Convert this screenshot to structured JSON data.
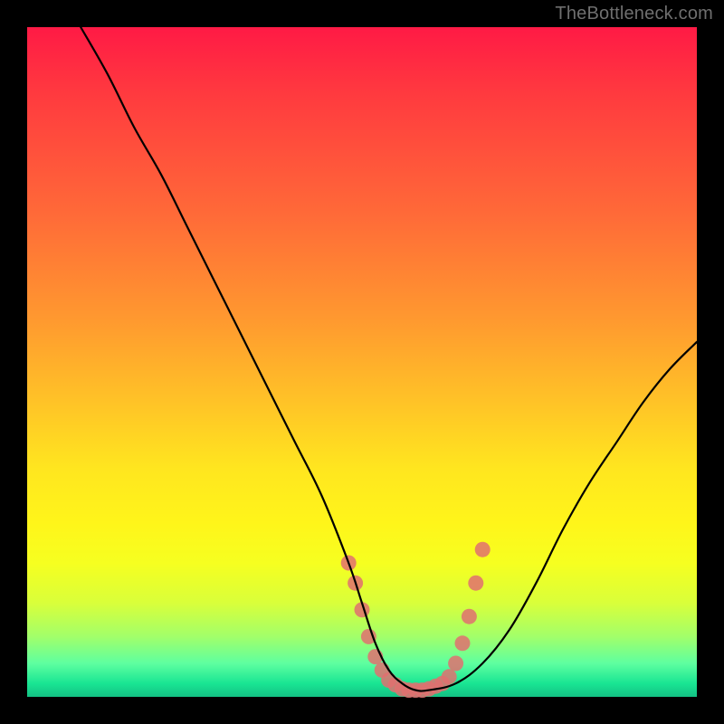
{
  "watermark": "TheBottleneck.com",
  "chart_data": {
    "type": "line",
    "title": "",
    "xlabel": "",
    "ylabel": "",
    "xlim": [
      0,
      100
    ],
    "ylim": [
      0,
      100
    ],
    "grid": false,
    "annotations": [],
    "series": [
      {
        "name": "curve",
        "color": "#000000",
        "x": [
          8,
          12,
          16,
          20,
          24,
          28,
          32,
          36,
          40,
          44,
          48,
          50,
          52,
          54,
          56,
          58,
          60,
          64,
          68,
          72,
          76,
          80,
          84,
          88,
          92,
          96,
          100
        ],
        "y": [
          100,
          93,
          85,
          78,
          70,
          62,
          54,
          46,
          38,
          30,
          20,
          14,
          8,
          4,
          2,
          1,
          1,
          2,
          5,
          10,
          17,
          25,
          32,
          38,
          44,
          49,
          53
        ]
      }
    ],
    "markers": [
      {
        "name": "highlight-dots",
        "color": "#e07070",
        "points": [
          {
            "x": 48,
            "y": 20
          },
          {
            "x": 49,
            "y": 17
          },
          {
            "x": 50,
            "y": 13
          },
          {
            "x": 51,
            "y": 9
          },
          {
            "x": 52,
            "y": 6
          },
          {
            "x": 53,
            "y": 4
          },
          {
            "x": 54,
            "y": 2.5
          },
          {
            "x": 55,
            "y": 1.8
          },
          {
            "x": 56,
            "y": 1.2
          },
          {
            "x": 57,
            "y": 1
          },
          {
            "x": 58,
            "y": 1
          },
          {
            "x": 59,
            "y": 1
          },
          {
            "x": 60,
            "y": 1.2
          },
          {
            "x": 61,
            "y": 1.6
          },
          {
            "x": 62,
            "y": 2
          },
          {
            "x": 63,
            "y": 3
          },
          {
            "x": 64,
            "y": 5
          },
          {
            "x": 65,
            "y": 8
          },
          {
            "x": 66,
            "y": 12
          },
          {
            "x": 67,
            "y": 17
          },
          {
            "x": 68,
            "y": 22
          }
        ]
      }
    ]
  }
}
